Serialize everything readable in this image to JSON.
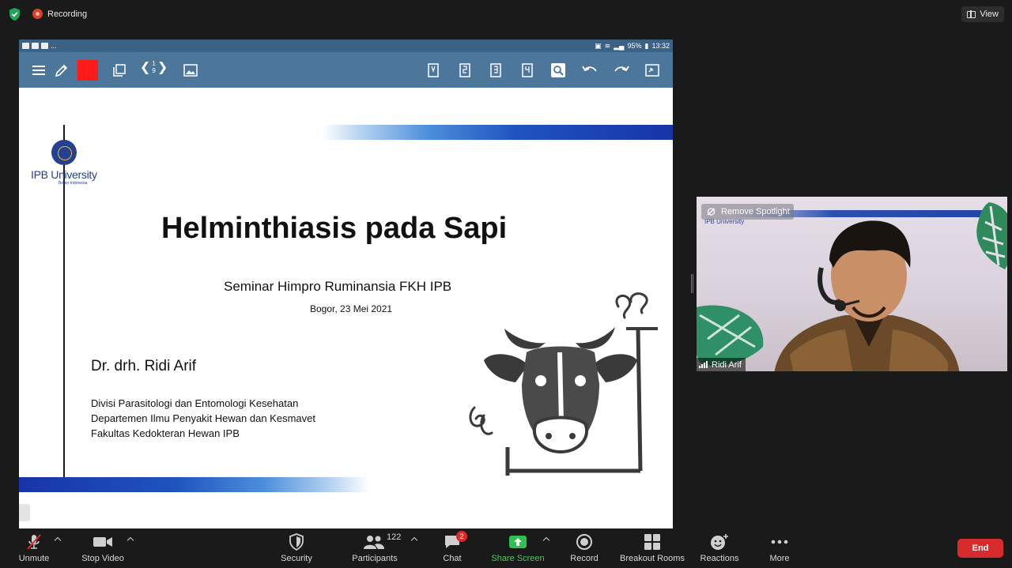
{
  "top": {
    "recording_label": "Recording",
    "view_label": "View"
  },
  "tablet": {
    "status_left": "...",
    "status_battery": "95%",
    "status_time": "13:32",
    "pager_current": "1",
    "pager_total": "9"
  },
  "slide": {
    "logo_name": "IPB University",
    "logo_sub": "Bogor Indonesia",
    "title": "Helminthiasis pada Sapi",
    "subtitle": "Seminar Himpro Ruminansia FKH IPB",
    "date": "Bogor, 23 Mei 2021",
    "author": "Dr. drh. Ridi Arif",
    "affiliation": [
      "Divisi Parasitologi dan Entomologi Kesehatan",
      "Departemen Ilmu Penyakit Hewan dan Kesmavet",
      "Fakultas Kedokteran Hewan IPB"
    ]
  },
  "video": {
    "spotlight_label": "Remove Spotlight",
    "participant_name": "Ridi Arif",
    "background_logo": "IPB University"
  },
  "controls": {
    "unmute": "Unmute",
    "stop_video": "Stop Video",
    "security": "Security",
    "participants": "Participants",
    "participants_count": "122",
    "chat": "Chat",
    "chat_badge": "2",
    "share_screen": "Share Screen",
    "record": "Record",
    "breakout_rooms": "Breakout Rooms",
    "reactions": "Reactions",
    "more": "More",
    "end": "End"
  },
  "colors": {
    "tablet_toolbar": "#4d769b",
    "tablet_statusbar": "#3b6185",
    "pen_color": "#ff1a1a",
    "slide_band": "#1f54bf",
    "share_green": "#3ecf5c",
    "end_red": "#d92b2b",
    "recording_red": "#d9412b"
  }
}
